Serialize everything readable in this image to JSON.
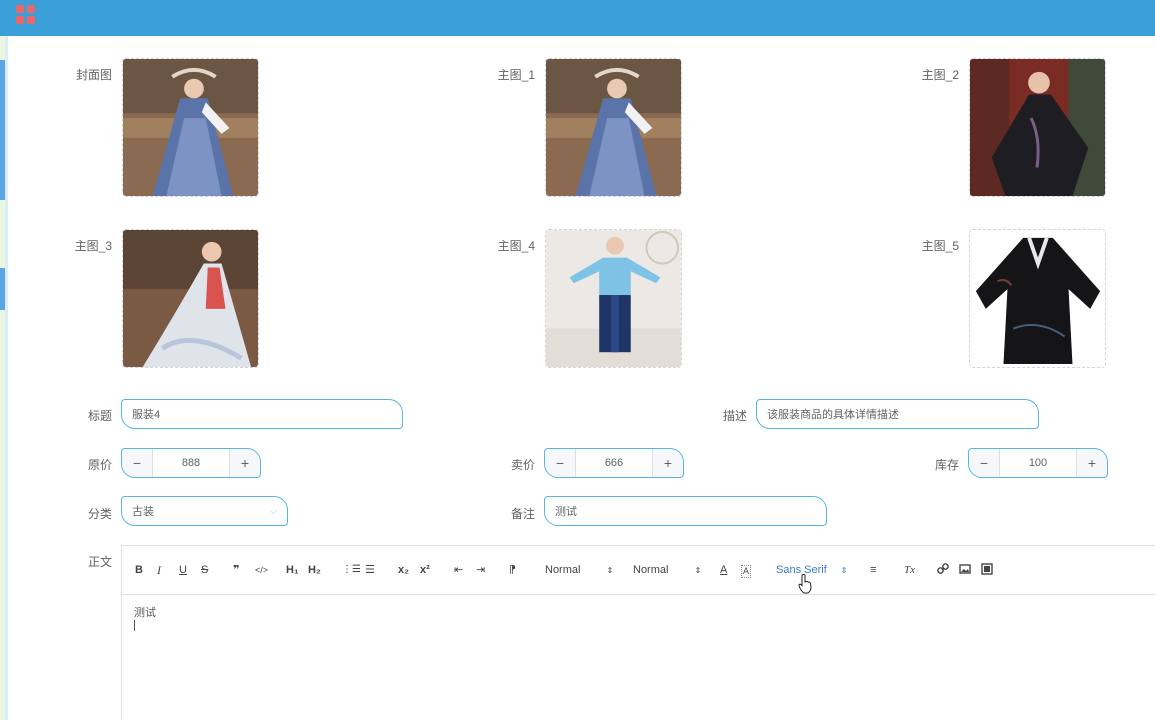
{
  "images": {
    "cover": {
      "label": "封面图",
      "icon": "hanfu-blue-dress-photo"
    },
    "main1": {
      "label": "主图_1",
      "icon": "hanfu-blue-dress-photo"
    },
    "main2": {
      "label": "主图_2",
      "icon": "hanfu-black-robe-photo"
    },
    "main3": {
      "label": "主图_3",
      "icon": "hanfu-white-dress-photo"
    },
    "main4": {
      "label": "主图_4",
      "icon": "hanfu-child-blue-photo"
    },
    "main5": {
      "label": "主图_5",
      "icon": "hanfu-black-robe-product-photo"
    }
  },
  "form": {
    "title": {
      "label": "标题",
      "value": "服装4"
    },
    "desc": {
      "label": "描述",
      "value": "该服装商品的具体详情描述"
    },
    "orig_price": {
      "label": "原价",
      "value": "888",
      "minus": "−",
      "plus": "+"
    },
    "sale_price": {
      "label": "卖价",
      "value": "666",
      "minus": "−",
      "plus": "+"
    },
    "stock": {
      "label": "库存",
      "value": "100",
      "minus": "−",
      "plus": "+"
    },
    "category": {
      "label": "分类",
      "value": "古装",
      "arrow": "⌵"
    },
    "remark": {
      "label": "备注",
      "value": "测试"
    }
  },
  "editor": {
    "label": "正文",
    "toolbar": {
      "bold": "B",
      "italic": "I",
      "underline": "U",
      "strike": "S",
      "quote": "❞",
      "code": "</>",
      "h1": "H₁",
      "h2": "H₂",
      "ordered_list": "⋮☰",
      "bullet_list": "☰",
      "sub": "x₂",
      "sup": "x²",
      "outdent": "⇤",
      "indent": "⇥",
      "direction": "⁋",
      "size_picker": "Normal",
      "header_picker": "Normal",
      "color": "A",
      "background": "A",
      "font_picker": "Sans Serif",
      "align": "≡",
      "clean": "Tx",
      "picker_arrow": "⇕"
    },
    "content": "测试"
  },
  "colors": {
    "topbar": "#3a9fd6",
    "accent_border": "#55b5e6",
    "logo": "#e8676b"
  }
}
